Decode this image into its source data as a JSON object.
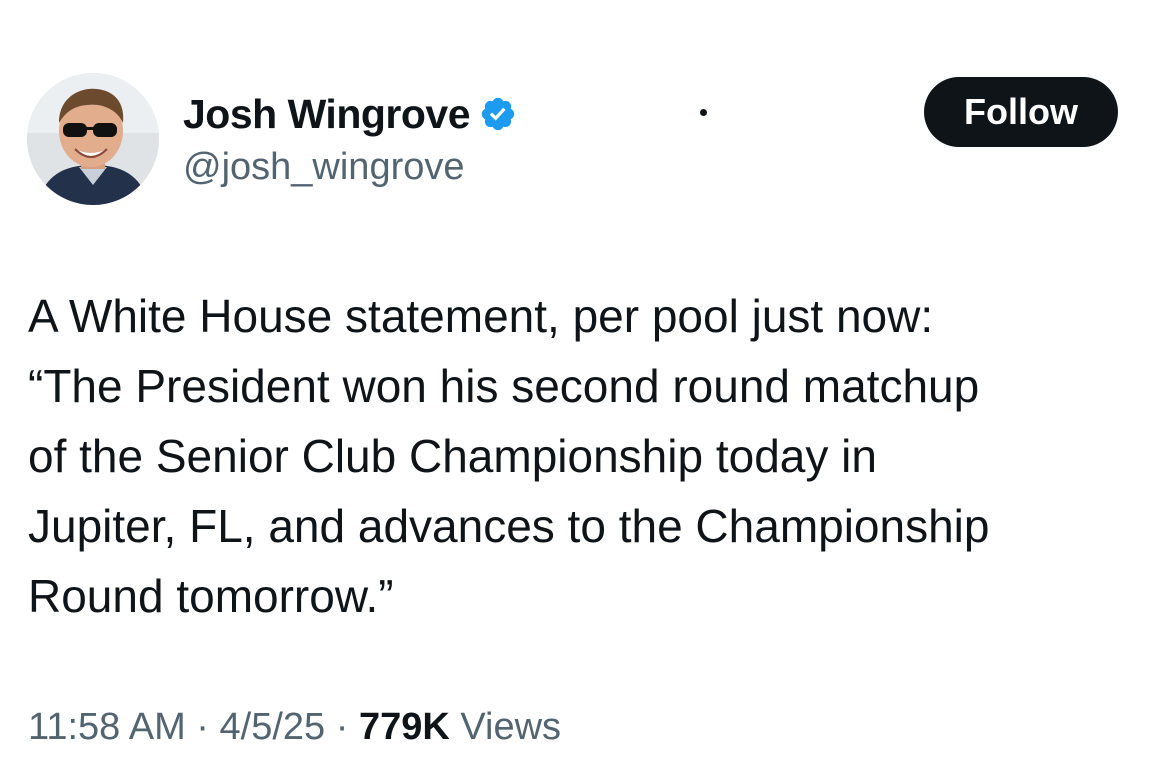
{
  "author": {
    "display_name": "Josh Wingrove",
    "handle": "@josh_wingrove",
    "verified_icon": "verified-badge-icon",
    "avatar_icon": "profile-photo"
  },
  "actions": {
    "follow_label": "Follow",
    "more_icon": "dot-icon"
  },
  "tweet": {
    "lines": [
      "A White House statement, per pool just now:",
      "“The President won his second round matchup",
      "of the Senior Club Championship today in",
      "Jupiter, FL, and advances to the Championship",
      "Round tomorrow.”"
    ]
  },
  "meta": {
    "time": "11:58 AM",
    "sep1": " · ",
    "date": "4/5/25",
    "sep2": " · ",
    "views_count": "779K",
    "views_label": " Views"
  },
  "colors": {
    "text_primary": "#0f1419",
    "text_secondary": "#536471",
    "verified_blue": "#1d9bf0",
    "button_bg": "#0f1419"
  }
}
